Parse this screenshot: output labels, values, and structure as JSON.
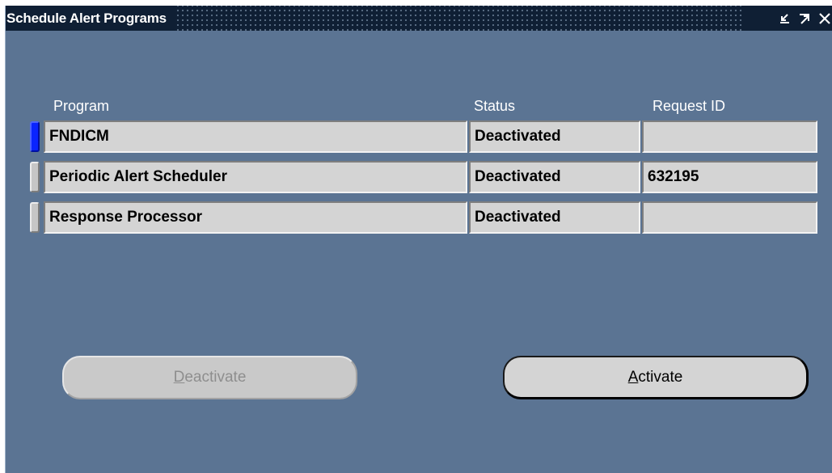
{
  "window": {
    "title": "Schedule Alert Programs"
  },
  "icons": {
    "minimize": "minimize-icon",
    "maximize": "maximize-icon",
    "close": "close-icon"
  },
  "table": {
    "headers": {
      "program": "Program",
      "status": "Status",
      "request_id": "Request ID"
    },
    "rows": [
      {
        "program": "FNDICM",
        "status": "Deactivated",
        "request_id": "",
        "current": true
      },
      {
        "program": "Periodic Alert Scheduler",
        "status": "Deactivated",
        "request_id": "632195",
        "current": false
      },
      {
        "program": "Response Processor",
        "status": "Deactivated",
        "request_id": "",
        "current": false
      }
    ]
  },
  "buttons": {
    "deactivate": {
      "mnemonic": "D",
      "rest": "eactivate",
      "enabled": false
    },
    "activate": {
      "mnemonic": "A",
      "rest": "ctivate",
      "enabled": true
    }
  },
  "colors": {
    "background": "#5b7493",
    "titlebar": "#0f1f34",
    "current_row_indicator": "#0a24ff"
  }
}
